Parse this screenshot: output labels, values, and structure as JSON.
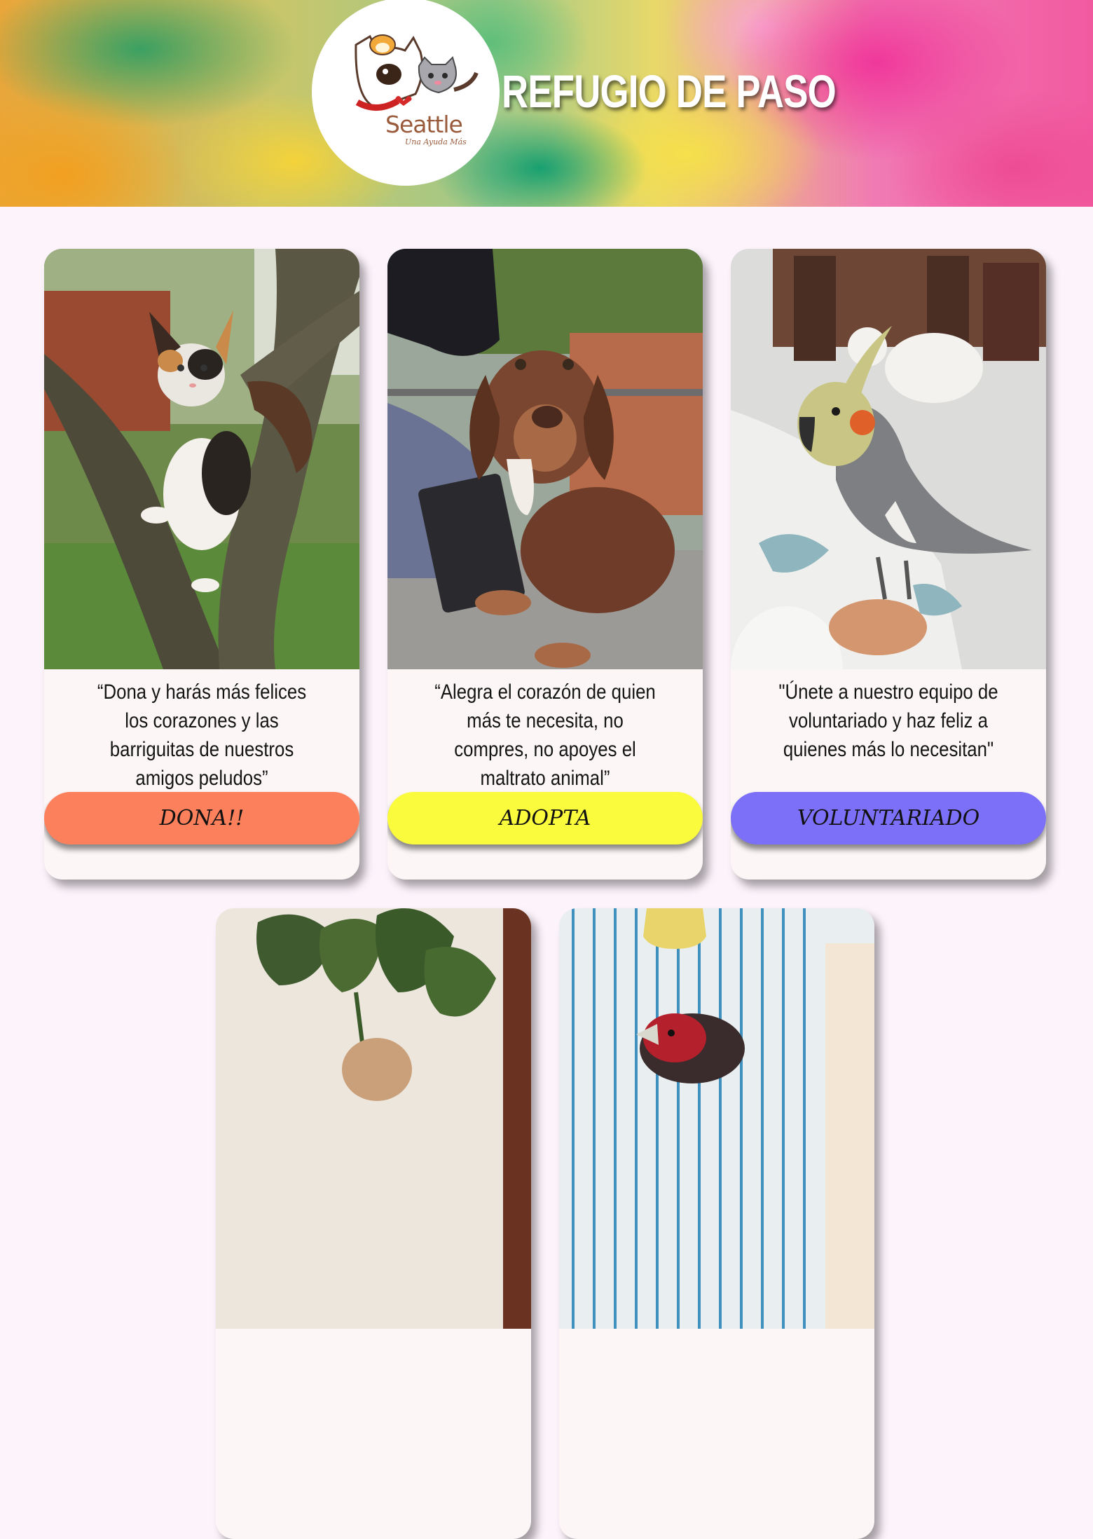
{
  "header": {
    "site_title": "REFUGIO DE PASO",
    "logo": {
      "wordmark": "Seattle",
      "tagline": "Una Ayuda Más"
    }
  },
  "cards": [
    {
      "quote": "“Dona y harás más felices los corazones y las barriguitas de nuestros amigos peludos”",
      "button_label": "DONA!!",
      "button_color": "#fd805d",
      "photo": "calico-kitten-in-tree"
    },
    {
      "quote": "“Alegra el corazón de quien más te necesita, no compres, no apoyes el maltrato animal”",
      "button_label": "ADOPTA",
      "button_color": "#fbfb3e",
      "photo": "brown-beagle-puppy"
    },
    {
      "quote": "\"Únete a nuestro equipo de voluntariado y haz feliz a quienes más lo necesitan\"",
      "button_label": "VOLUNTARIADO",
      "button_color": "#7c6ff8",
      "photo": "grey-cockatiel"
    },
    {
      "photo": "house-plant"
    },
    {
      "photo": "finch-in-cage"
    }
  ],
  "colors": {
    "page_background": "#fcf3fb",
    "card_background": "#fcf6f6"
  }
}
